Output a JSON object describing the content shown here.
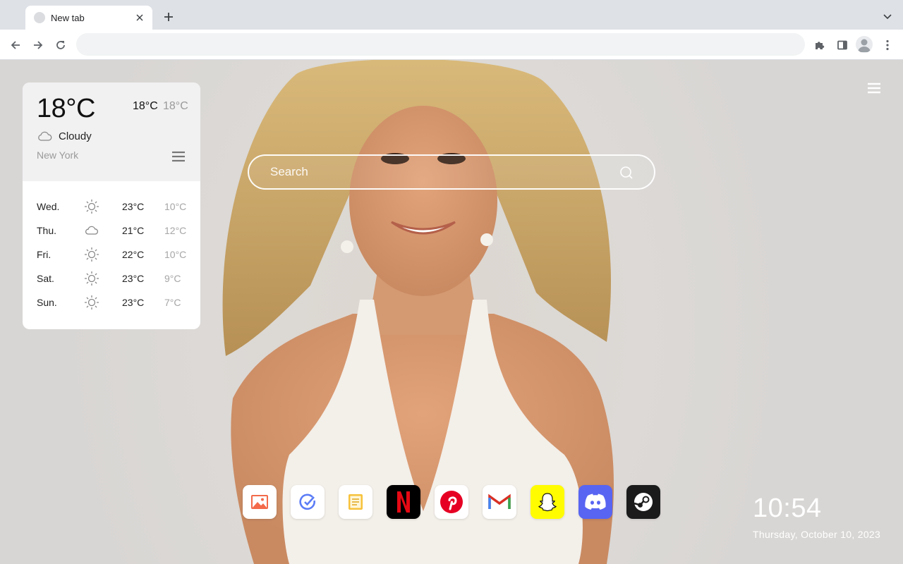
{
  "browser": {
    "tab_title": "New tab",
    "address_value": ""
  },
  "weather": {
    "current_temp": "18°C",
    "high": "18°C",
    "low": "18°C",
    "condition": "Cloudy",
    "city": "New York",
    "forecast": [
      {
        "day": "Wed.",
        "icon": "sun-icon",
        "high": "23°C",
        "low": "10°C"
      },
      {
        "day": "Thu.",
        "icon": "cloud-icon",
        "high": "21°C",
        "low": "12°C"
      },
      {
        "day": "Fri.",
        "icon": "sun-icon",
        "high": "22°C",
        "low": "10°C"
      },
      {
        "day": "Sat.",
        "icon": "sun-icon",
        "high": "23°C",
        "low": "9°C"
      },
      {
        "day": "Sun.",
        "icon": "sun-icon",
        "high": "23°C",
        "low": "7°C"
      }
    ]
  },
  "search": {
    "placeholder": "Search"
  },
  "dock": [
    {
      "name": "photos",
      "icon": "photo-icon",
      "bg": "#ffffff"
    },
    {
      "name": "tasks",
      "icon": "check-circle-icon",
      "bg": "#ffffff"
    },
    {
      "name": "notes",
      "icon": "note-icon",
      "bg": "#ffffff"
    },
    {
      "name": "netflix",
      "icon": "netflix-icon",
      "bg": "#000000"
    },
    {
      "name": "pinterest",
      "icon": "pinterest-icon",
      "bg": "#ffffff"
    },
    {
      "name": "gmail",
      "icon": "gmail-icon",
      "bg": "#ffffff"
    },
    {
      "name": "snapchat",
      "icon": "snapchat-icon",
      "bg": "#fffc00"
    },
    {
      "name": "discord",
      "icon": "discord-icon",
      "bg": "#5865f2"
    },
    {
      "name": "steam",
      "icon": "steam-icon",
      "bg": "#1b1b1b"
    }
  ],
  "clock": {
    "time": "10:54",
    "date": "Thursday, October 10, 2023"
  }
}
